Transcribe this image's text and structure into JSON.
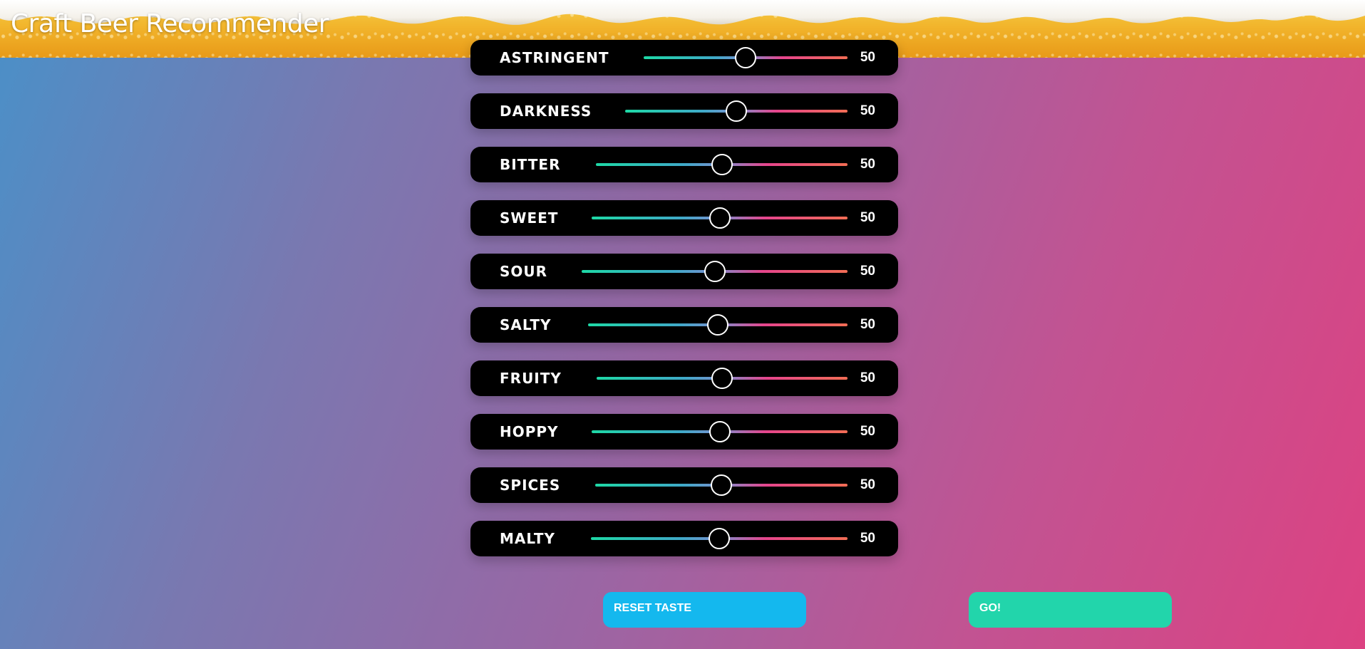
{
  "app": {
    "title": "Craft Beer Recommender"
  },
  "colors": {
    "background_start": "#4a90c8",
    "background_end": "#dc4282",
    "slider_row_bg": "#000000",
    "track_gradient": [
      "#1ed8a6",
      "#3fa9c8",
      "#7b8fd0",
      "#e6458c",
      "#f26d55"
    ],
    "reset_button": "#14b8ee",
    "go_button": "#22d5ab",
    "banner_beer": "#f2b52c",
    "banner_foam": "#ffffff"
  },
  "sliders": [
    {
      "label": "ASTRINGENT",
      "value": "50",
      "level": 50
    },
    {
      "label": "DARKNESS",
      "value": "50",
      "level": 50
    },
    {
      "label": "BITTER",
      "value": "50",
      "level": 50
    },
    {
      "label": "SWEET",
      "value": "50",
      "level": 50
    },
    {
      "label": "SOUR",
      "value": "50",
      "level": 50
    },
    {
      "label": "SALTY",
      "value": "50",
      "level": 50
    },
    {
      "label": "FRUITY",
      "value": "50",
      "level": 50
    },
    {
      "label": "HOPPY",
      "value": "50",
      "level": 50
    },
    {
      "label": "SPICES",
      "value": "50",
      "level": 50
    },
    {
      "label": "MALTY",
      "value": "50",
      "level": 50
    }
  ],
  "actions": {
    "reset_label": "RESET TASTE",
    "go_label": "GO!"
  }
}
